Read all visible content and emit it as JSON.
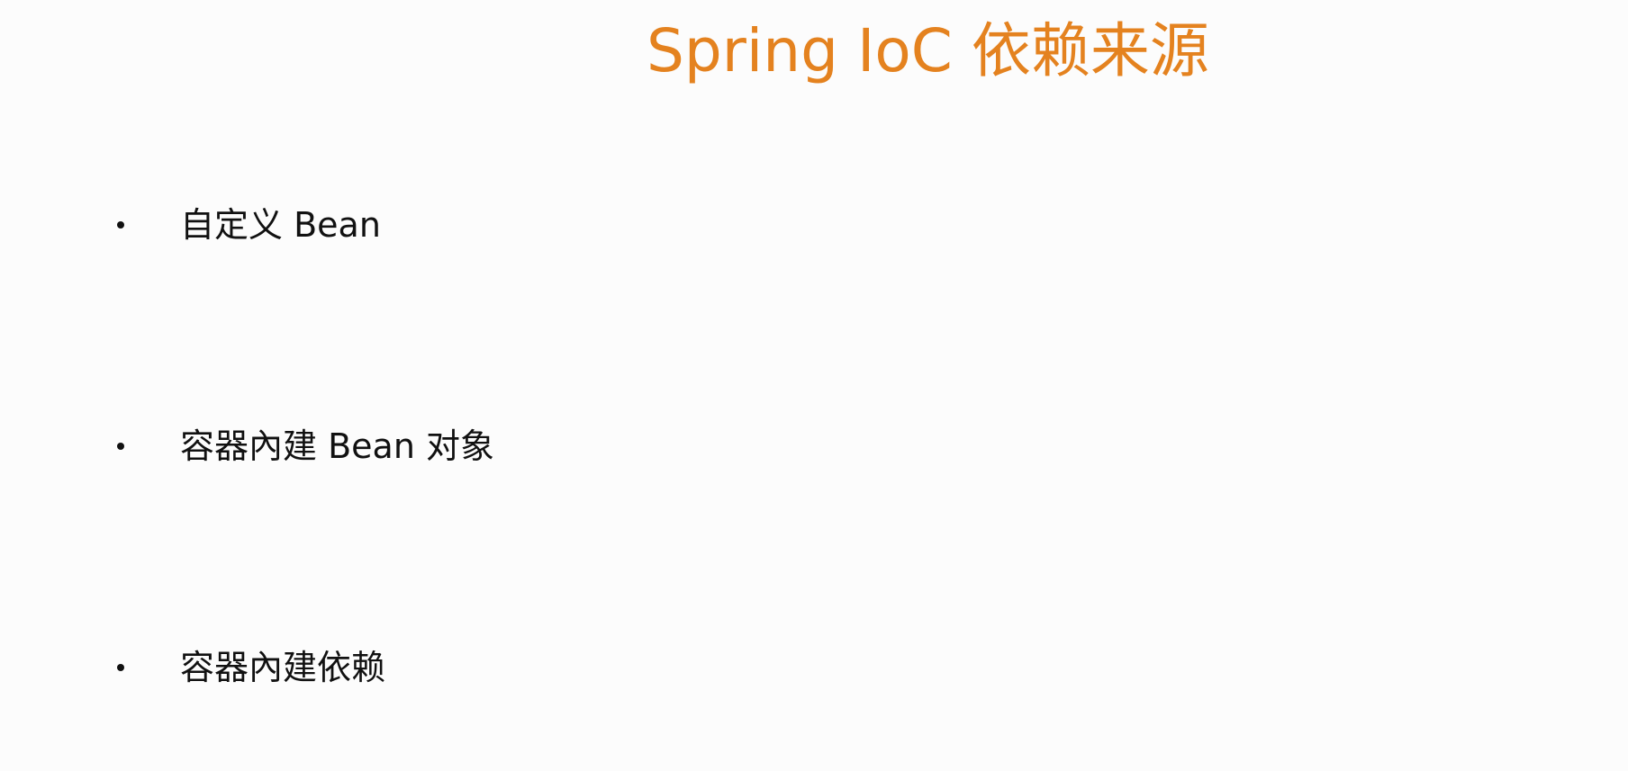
{
  "slide": {
    "title": "Spring IoC 依赖来源",
    "bullets": [
      {
        "text": "自定义 Bean"
      },
      {
        "text": "容器內建 Bean 对象"
      },
      {
        "text": "容器內建依赖"
      }
    ]
  },
  "colors": {
    "background": "#fcfcfc",
    "title": "#e4821f",
    "body_text": "#111111"
  }
}
